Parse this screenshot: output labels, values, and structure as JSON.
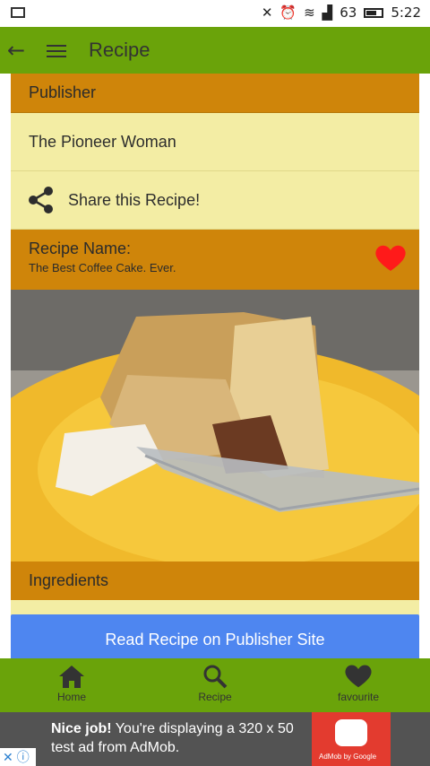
{
  "status_bar": {
    "signal": "63",
    "time": "5:22"
  },
  "app_bar": {
    "title": "Recipe"
  },
  "publisher": {
    "header": "Publisher",
    "name": "The Pioneer Woman"
  },
  "share": {
    "label": "Share this Recipe!"
  },
  "recipe": {
    "name_label": "Recipe Name:",
    "name_value": "The Best Coffee Cake. Ever."
  },
  "ingredients": {
    "header": "Ingredients"
  },
  "actions": {
    "read_recipe": "Read Recipe on Publisher Site"
  },
  "bottom_nav": {
    "items": [
      {
        "label": "Home"
      },
      {
        "label": "Recipe"
      },
      {
        "label": "favourite"
      }
    ]
  },
  "ad": {
    "headline": "Nice job!",
    "body": " You're displaying a 320 x 50 test ad from AdMob.",
    "badge_text": "AdMob by Google"
  },
  "colors": {
    "primary": "#6aa30a",
    "section": "#cf850a",
    "card": "#f3eda4",
    "button": "#4e86f0",
    "heart": "#ff1a1a"
  }
}
